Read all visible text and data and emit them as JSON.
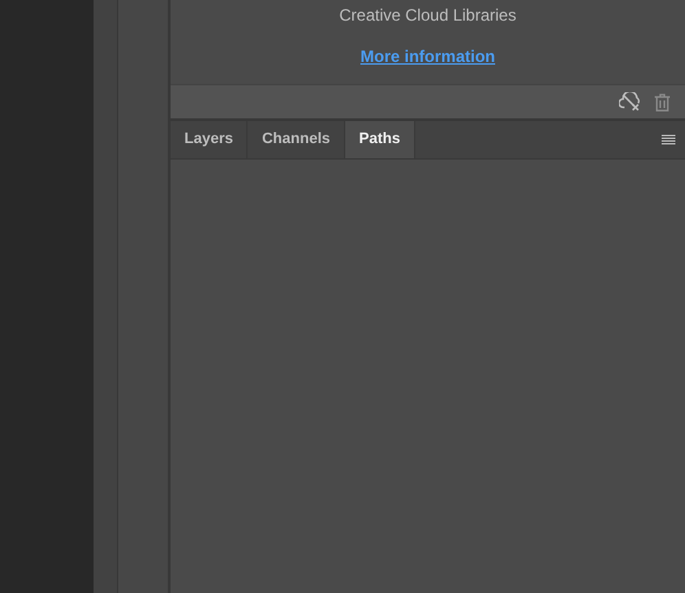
{
  "libraries": {
    "text": "Creative Cloud Libraries",
    "link": "More information"
  },
  "tabs": [
    {
      "label": "Layers",
      "selected": false
    },
    {
      "label": "Channels",
      "selected": false
    },
    {
      "label": "Paths",
      "selected": true
    }
  ]
}
